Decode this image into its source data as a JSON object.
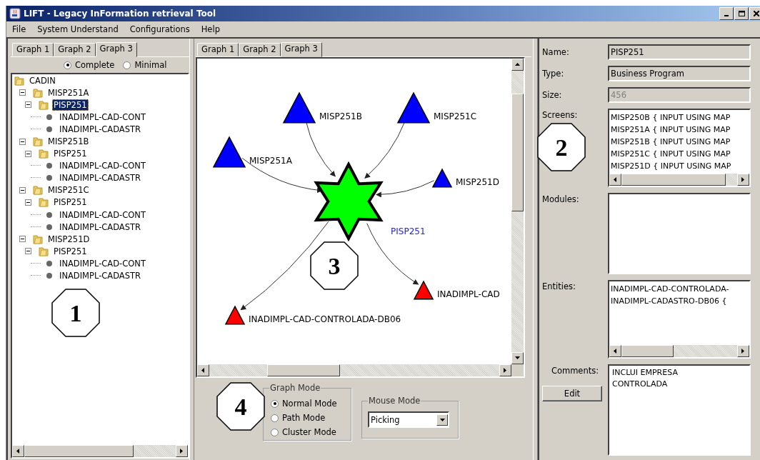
{
  "window": {
    "title": "LIFT - Legacy InFormation retrieval Tool"
  },
  "menu": [
    "File",
    "System Understand",
    "Configurations",
    "Help"
  ],
  "left_panel": {
    "tabs": [
      {
        "label": "Graph 1",
        "selected": false
      },
      {
        "label": "Graph 2",
        "selected": false
      },
      {
        "label": "Graph 3",
        "selected": true
      }
    ],
    "view_options": [
      {
        "label": "Complete",
        "selected": true
      },
      {
        "label": "Minimal",
        "selected": false
      }
    ],
    "tree": [
      {
        "label": "CADIN",
        "kind": "folder",
        "selected": false,
        "children": [
          {
            "label": "MISP251A",
            "kind": "folder",
            "expanded": true,
            "selected": false,
            "children": [
              {
                "label": "PISP251",
                "kind": "folder",
                "expanded": true,
                "selected": true,
                "children": [
                  {
                    "label": "INADIMPL-CAD-CONT",
                    "kind": "entity",
                    "selected": false
                  },
                  {
                    "label": "INADIMPL-CADASTR",
                    "kind": "entity",
                    "selected": false
                  }
                ]
              }
            ]
          },
          {
            "label": "MISP251B",
            "kind": "folder",
            "expanded": true,
            "selected": false,
            "children": [
              {
                "label": "PISP251",
                "kind": "folder",
                "expanded": true,
                "selected": false,
                "children": [
                  {
                    "label": "INADIMPL-CAD-CONT",
                    "kind": "entity",
                    "selected": false
                  },
                  {
                    "label": "INADIMPL-CADASTR",
                    "kind": "entity",
                    "selected": false
                  }
                ]
              }
            ]
          },
          {
            "label": "MISP251C",
            "kind": "folder",
            "expanded": true,
            "selected": false,
            "children": [
              {
                "label": "PISP251",
                "kind": "folder",
                "expanded": true,
                "selected": false,
                "children": [
                  {
                    "label": "INADIMPL-CAD-CONT",
                    "kind": "entity",
                    "selected": false
                  },
                  {
                    "label": "INADIMPL-CADASTR",
                    "kind": "entity",
                    "selected": false
                  }
                ]
              }
            ]
          },
          {
            "label": "MISP251D",
            "kind": "folder",
            "expanded": true,
            "selected": false,
            "children": [
              {
                "label": "PISP251",
                "kind": "folder",
                "expanded": true,
                "selected": false,
                "children": [
                  {
                    "label": "INADIMPL-CAD-CONT",
                    "kind": "entity",
                    "selected": false
                  },
                  {
                    "label": "INADIMPL-CADASTR",
                    "kind": "entity",
                    "selected": false
                  }
                ]
              }
            ]
          }
        ]
      }
    ]
  },
  "graph_panel": {
    "tabs": [
      {
        "label": "Graph 1",
        "selected": false
      },
      {
        "label": "Graph 2",
        "selected": false
      },
      {
        "label": "Graph 3",
        "selected": true
      }
    ],
    "nodes": [
      {
        "label": "MISP251A",
        "kind": "source",
        "color": "#0000ff",
        "selected": false
      },
      {
        "label": "MISP251B",
        "kind": "source",
        "color": "#0000ff",
        "selected": false
      },
      {
        "label": "MISP251C",
        "kind": "source",
        "color": "#0000ff",
        "selected": false
      },
      {
        "label": "MISP251D",
        "kind": "source",
        "color": "#0000ff",
        "selected": false
      },
      {
        "label": "PISP251",
        "kind": "center",
        "color": "#00ff00",
        "selected": true
      },
      {
        "label": "INADIMPL-CAD",
        "kind": "target",
        "color": "#ff0000",
        "selected": false
      },
      {
        "label": "INADIMPL-CAD-CONTROLADA-DB06",
        "kind": "target",
        "color": "#ff0000",
        "selected": false
      }
    ],
    "graph_mode": {
      "title": "Graph Mode",
      "options": [
        {
          "label": "Normal Mode",
          "selected": true
        },
        {
          "label": "Path Mode",
          "selected": false
        },
        {
          "label": "Cluster Mode",
          "selected": false
        }
      ]
    },
    "mouse_mode": {
      "title": "Mouse Mode",
      "value": "Picking"
    }
  },
  "details": {
    "fields": [
      {
        "label": "Name:",
        "value": "PISP251",
        "disabled": false
      },
      {
        "label": "Type:",
        "value": "Business Program",
        "disabled": false
      },
      {
        "label": "Size:",
        "value": "456",
        "disabled": true
      }
    ],
    "lists": [
      {
        "label": "Screens:",
        "items": [
          "MISP250B { INPUT USING MAP",
          "MISP251A { INPUT USING MAP",
          "MISP251B { INPUT USING MAP",
          "MISP251C { INPUT USING MAP",
          "MISP251D { INPUT USING MAP"
        ]
      },
      {
        "label": "Modules:"
      },
      {
        "label": "Entities:",
        "items": [
          "INADIMPL-CAD-CONTROLADA-",
          "INADIMPL-CADASTRO-DB06 {"
        ]
      }
    ],
    "comments": {
      "label": "Comments:",
      "text": "INCLUI EMPRESA\nCONTROLADA"
    },
    "edit_button": "Edit"
  },
  "callouts": [
    "1",
    "2",
    "3",
    "4"
  ]
}
